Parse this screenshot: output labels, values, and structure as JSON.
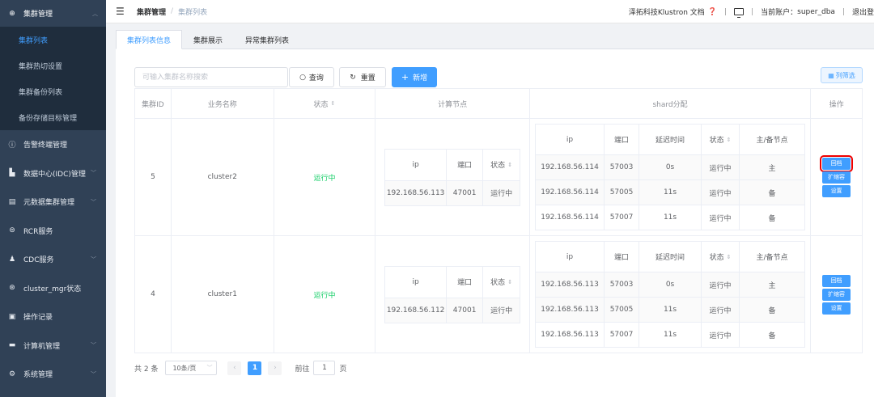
{
  "sidebar": {
    "group": {
      "label": "集群管理",
      "icon": "plus-circle-icon"
    },
    "sub_items": [
      {
        "label": "集群列表",
        "active": true
      },
      {
        "label": "集群热切设置",
        "active": false
      },
      {
        "label": "集群备份列表",
        "active": false
      },
      {
        "label": "备份存储目标管理",
        "active": false
      }
    ],
    "items": [
      {
        "label": "告警终端管理",
        "icon": "info-circle-icon",
        "has_arrow": false
      },
      {
        "label": "数据中心(IDC)管理",
        "icon": "building-icon",
        "has_arrow": true
      },
      {
        "label": "元数据集群管理",
        "icon": "table-icon",
        "has_arrow": true
      },
      {
        "label": "RCR服务",
        "icon": "link-icon",
        "has_arrow": false
      },
      {
        "label": "CDC服务",
        "icon": "user-icon",
        "has_arrow": true
      },
      {
        "label": "cluster_mgr状态",
        "icon": "cog-circle-icon",
        "has_arrow": false
      },
      {
        "label": "操作记录",
        "icon": "document-icon",
        "has_arrow": false
      },
      {
        "label": "计算机管理",
        "icon": "monitor-icon",
        "has_arrow": true
      },
      {
        "label": "系统管理",
        "icon": "gear-icon",
        "has_arrow": true
      }
    ]
  },
  "header": {
    "breadcrumb": [
      "集群管理",
      "集群列表"
    ],
    "docs_link": "泽拓科技Klustron 文档",
    "account_label": "当前账户：",
    "account_user": "super_dba",
    "logout": "退出登"
  },
  "tabs": [
    "集群列表信息",
    "集群展示",
    "异常集群列表"
  ],
  "toolbar": {
    "search_placeholder": "可输入集群名称搜索",
    "query_label": "查询",
    "reset_label": "重置",
    "add_label": "新增",
    "column_filter_label": "列筛选"
  },
  "table": {
    "headers": {
      "id": "集群ID",
      "name": "业务名称",
      "status": "状态",
      "compute": "计算节点",
      "shard": "shard分配",
      "ops": "操作"
    },
    "compute_headers": {
      "ip": "ip",
      "port": "端口",
      "status": "状态"
    },
    "shard_headers": {
      "ip": "ip",
      "port": "端口",
      "delay": "延迟时间",
      "status": "状态",
      "role": "主/备节点"
    },
    "op_labels": {
      "rollback": "回档",
      "scale": "扩缩容",
      "settings": "设置"
    },
    "rows": [
      {
        "id": "5",
        "name": "cluster2",
        "status": "运行中",
        "compute": [
          {
            "ip": "192.168.56.113",
            "port": "47001",
            "status": "运行中"
          }
        ],
        "shards": [
          {
            "ip": "192.168.56.114",
            "port": "57003",
            "delay": "0s",
            "status": "运行中",
            "role": "主"
          },
          {
            "ip": "192.168.56.114",
            "port": "57005",
            "delay": "11s",
            "status": "运行中",
            "role": "备"
          },
          {
            "ip": "192.168.56.114",
            "port": "57007",
            "delay": "11s",
            "status": "运行中",
            "role": "备"
          }
        ]
      },
      {
        "id": "4",
        "name": "cluster1",
        "status": "运行中",
        "compute": [
          {
            "ip": "192.168.56.112",
            "port": "47001",
            "status": "运行中"
          }
        ],
        "shards": [
          {
            "ip": "192.168.56.113",
            "port": "57003",
            "delay": "0s",
            "status": "运行中",
            "role": "主"
          },
          {
            "ip": "192.168.56.113",
            "port": "57005",
            "delay": "11s",
            "status": "运行中",
            "role": "备"
          },
          {
            "ip": "192.168.56.113",
            "port": "57007",
            "delay": "11s",
            "status": "运行中",
            "role": "备"
          }
        ]
      }
    ]
  },
  "pagination": {
    "total": "共 2 条",
    "page_size": "10条/页",
    "current_page": "1",
    "goto_label": "前往",
    "goto_value": "1",
    "page_unit": "页"
  },
  "colors": {
    "sidebar_bg": "#304156",
    "submenu_bg": "#1f2d3d",
    "primary": "#409eff",
    "running": "#13ce66",
    "highlight": "#e00000"
  }
}
